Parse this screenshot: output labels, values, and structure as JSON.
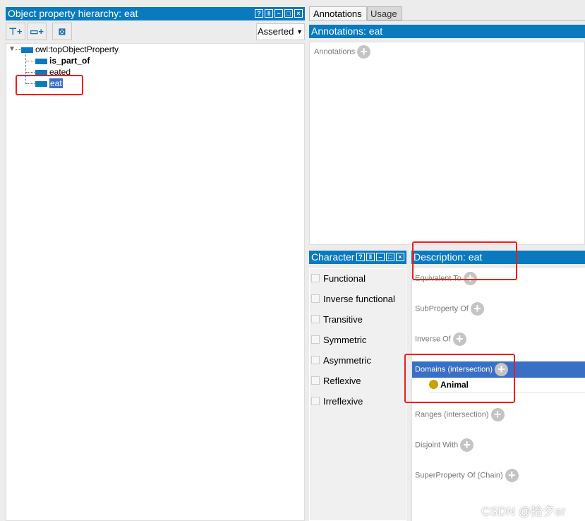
{
  "hierarchy": {
    "title": "Object property hierarchy: eat",
    "mode": "Asserted",
    "root": "owl:topObjectProperty",
    "children": [
      "is_part_of",
      "eated",
      "eat"
    ],
    "selected": "eat"
  },
  "tabs": [
    "Annotations",
    "Usage"
  ],
  "annotations": {
    "title": "Annotations: eat",
    "label": "Annotations"
  },
  "characteristics": {
    "title": "Characteristics",
    "items": [
      "Functional",
      "Inverse functional",
      "Transitive",
      "Symmetric",
      "Asymmetric",
      "Reflexive",
      "Irreflexive"
    ]
  },
  "description": {
    "title": "Description: eat",
    "sections": [
      "Equivalent To",
      "SubProperty Of",
      "Inverse Of",
      "Domains (intersection)",
      "Ranges (intersection)",
      "Disjoint With",
      "SuperProperty Of (Chain)"
    ],
    "domain_item": "Animal"
  },
  "watermark": "CSDN @拾夕er",
  "colors": {
    "header": "#0a7abf",
    "selected_section": "#3a6fc6",
    "class_dot": "#c9a200",
    "highlight_box": "#f01c1c"
  }
}
